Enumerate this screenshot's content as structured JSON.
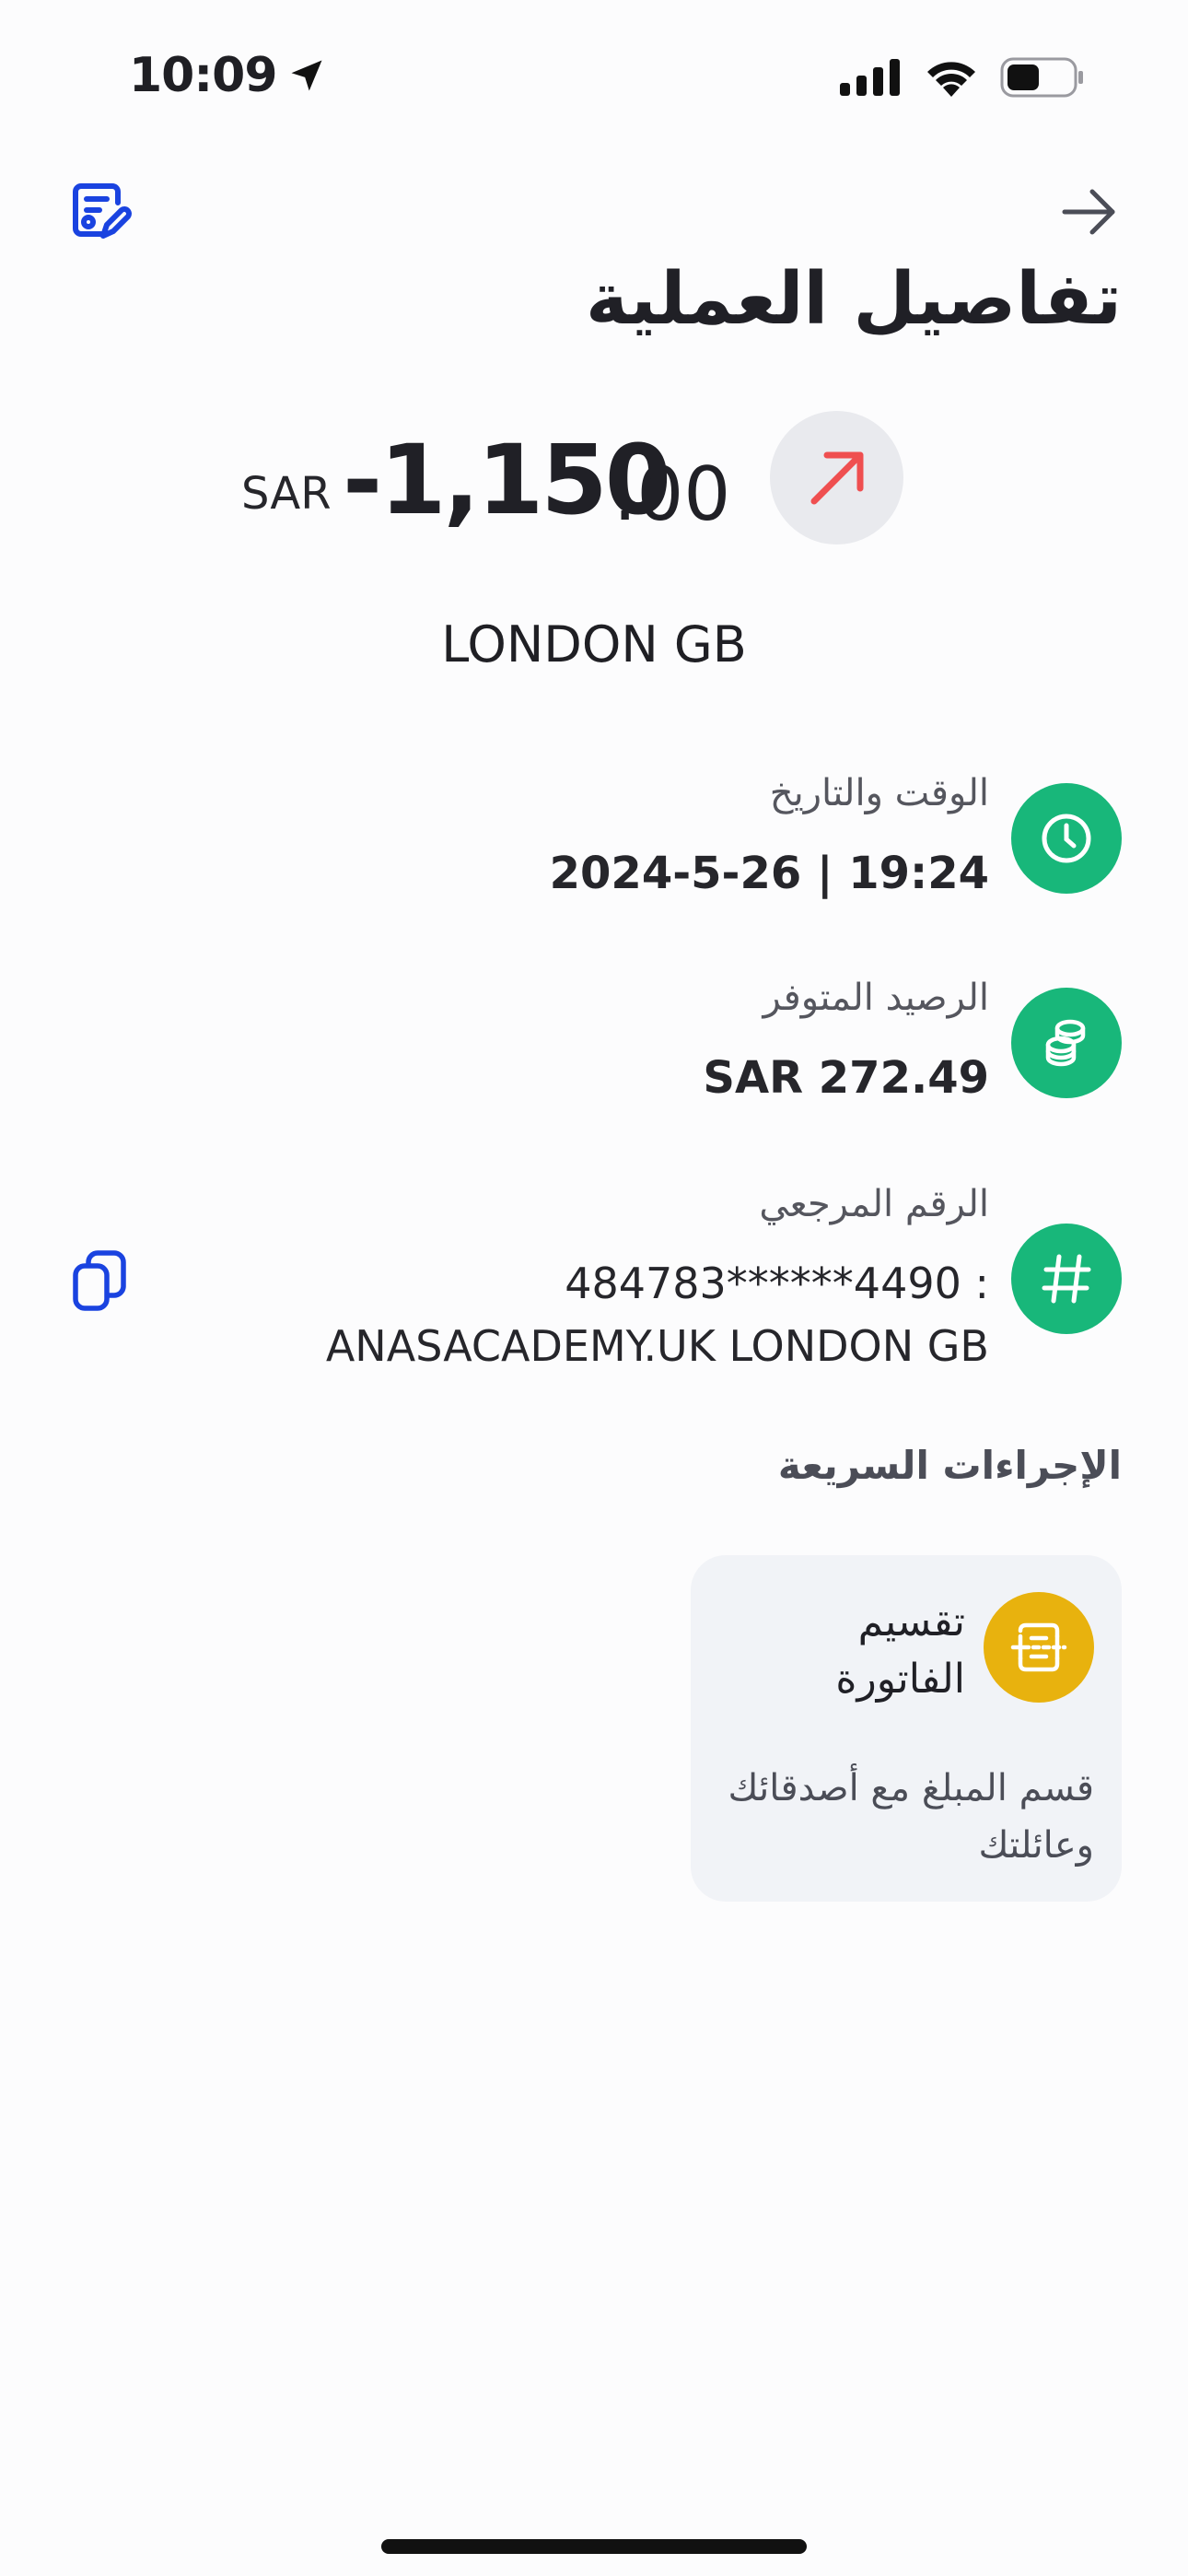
{
  "status_bar": {
    "time": "10:09"
  },
  "header": {
    "title": "تفاصيل العملية"
  },
  "transaction": {
    "currency": "SAR",
    "amount_main": "-1,150",
    "amount_decimal": ".00",
    "merchant": "LONDON GB"
  },
  "details": {
    "datetime_label": "الوقت والتاريخ",
    "datetime_value": "2024-5-26 | 19:24",
    "balance_label": "الرصيد المتوفر",
    "balance_value": "SAR 272.49",
    "reference_label": "الرقم المرجعي",
    "reference_value_line1": "484783******4490   :",
    "reference_value_line2": "ANASACADEMY.UK LONDON GB"
  },
  "quick_actions": {
    "title": "الإجراءات السريعة",
    "items": [
      {
        "name": "تقسيم الفاتورة",
        "description": "قسم المبلغ مع أصدقائك وعائلتك"
      }
    ]
  },
  "colors": {
    "accent_blue": "#1a43e0",
    "detail_green": "#18b77a",
    "quick_yellow": "#e8b20e",
    "arrow_red": "#ef4f50"
  }
}
